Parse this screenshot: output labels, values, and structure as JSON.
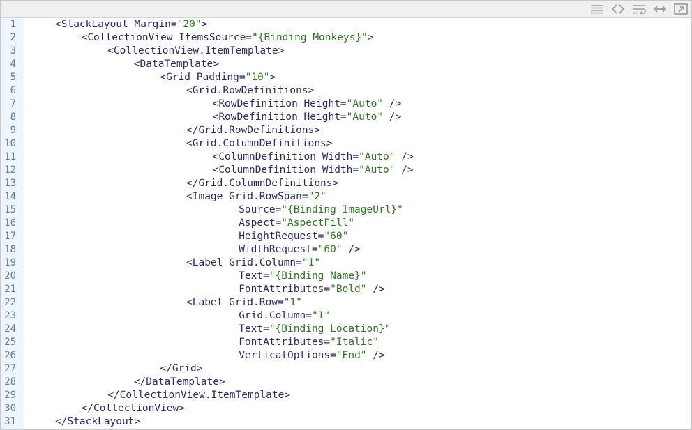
{
  "toolbar": {
    "icons": [
      "view-source-icon",
      "code-icon",
      "wrap-lines-icon",
      "expand-width-icon",
      "open-window-icon"
    ]
  },
  "code": {
    "lines": [
      {
        "num": "1",
        "indent": 0,
        "parts": [
          {
            "t": "<StackLayout Margin=",
            "c": "tag"
          },
          {
            "t": "\"20\"",
            "c": "str"
          },
          {
            "t": ">",
            "c": "tag"
          }
        ]
      },
      {
        "num": "2",
        "indent": 1,
        "parts": [
          {
            "t": "<CollectionView ItemsSource=",
            "c": "tag"
          },
          {
            "t": "\"{Binding Monkeys}\"",
            "c": "str"
          },
          {
            "t": ">",
            "c": "tag"
          }
        ]
      },
      {
        "num": "3",
        "indent": 2,
        "parts": [
          {
            "t": "<CollectionView.ItemTemplate>",
            "c": "tag"
          }
        ]
      },
      {
        "num": "4",
        "indent": 3,
        "parts": [
          {
            "t": "<DataTemplate>",
            "c": "tag"
          }
        ]
      },
      {
        "num": "5",
        "indent": 4,
        "parts": [
          {
            "t": "<Grid Padding=",
            "c": "tag"
          },
          {
            "t": "\"10\"",
            "c": "str"
          },
          {
            "t": ">",
            "c": "tag"
          }
        ]
      },
      {
        "num": "6",
        "indent": 5,
        "parts": [
          {
            "t": "<Grid.RowDefinitions>",
            "c": "tag"
          }
        ]
      },
      {
        "num": "7",
        "indent": 6,
        "parts": [
          {
            "t": "<RowDefinition Height=",
            "c": "tag"
          },
          {
            "t": "\"Auto\"",
            "c": "str"
          },
          {
            "t": " />",
            "c": "tag"
          }
        ]
      },
      {
        "num": "8",
        "indent": 6,
        "parts": [
          {
            "t": "<RowDefinition Height=",
            "c": "tag"
          },
          {
            "t": "\"Auto\"",
            "c": "str"
          },
          {
            "t": " />",
            "c": "tag"
          }
        ]
      },
      {
        "num": "9",
        "indent": 5,
        "parts": [
          {
            "t": "</Grid.RowDefinitions>",
            "c": "tag"
          }
        ]
      },
      {
        "num": "10",
        "indent": 5,
        "parts": [
          {
            "t": "<Grid.ColumnDefinitions>",
            "c": "tag"
          }
        ]
      },
      {
        "num": "11",
        "indent": 6,
        "parts": [
          {
            "t": "<ColumnDefinition Width=",
            "c": "tag"
          },
          {
            "t": "\"Auto\"",
            "c": "str"
          },
          {
            "t": " />",
            "c": "tag"
          }
        ]
      },
      {
        "num": "12",
        "indent": 6,
        "parts": [
          {
            "t": "<ColumnDefinition Width=",
            "c": "tag"
          },
          {
            "t": "\"Auto\"",
            "c": "str"
          },
          {
            "t": " />",
            "c": "tag"
          }
        ]
      },
      {
        "num": "13",
        "indent": 5,
        "parts": [
          {
            "t": "</Grid.ColumnDefinitions>",
            "c": "tag"
          }
        ]
      },
      {
        "num": "14",
        "indent": 5,
        "parts": [
          {
            "t": "<Image Grid.RowSpan=",
            "c": "tag"
          },
          {
            "t": "\"2\"",
            "c": "str"
          }
        ]
      },
      {
        "num": "15",
        "indent": 7,
        "parts": [
          {
            "t": "Source=",
            "c": "tag"
          },
          {
            "t": "\"{Binding ImageUrl}\"",
            "c": "str"
          }
        ]
      },
      {
        "num": "16",
        "indent": 7,
        "parts": [
          {
            "t": "Aspect=",
            "c": "tag"
          },
          {
            "t": "\"AspectFill\"",
            "c": "str"
          }
        ]
      },
      {
        "num": "17",
        "indent": 7,
        "parts": [
          {
            "t": "HeightRequest=",
            "c": "tag"
          },
          {
            "t": "\"60\"",
            "c": "str"
          }
        ]
      },
      {
        "num": "18",
        "indent": 7,
        "parts": [
          {
            "t": "WidthRequest=",
            "c": "tag"
          },
          {
            "t": "\"60\"",
            "c": "str"
          },
          {
            "t": " />",
            "c": "tag"
          }
        ]
      },
      {
        "num": "19",
        "indent": 5,
        "parts": [
          {
            "t": "<Label Grid.Column=",
            "c": "tag"
          },
          {
            "t": "\"1\"",
            "c": "str"
          }
        ]
      },
      {
        "num": "20",
        "indent": 7,
        "parts": [
          {
            "t": "Text=",
            "c": "tag"
          },
          {
            "t": "\"{Binding Name}\"",
            "c": "str"
          }
        ]
      },
      {
        "num": "21",
        "indent": 7,
        "parts": [
          {
            "t": "FontAttributes=",
            "c": "tag"
          },
          {
            "t": "\"Bold\"",
            "c": "str"
          },
          {
            "t": " />",
            "c": "tag"
          }
        ]
      },
      {
        "num": "22",
        "indent": 5,
        "parts": [
          {
            "t": "<Label Grid.Row=",
            "c": "tag"
          },
          {
            "t": "\"1\"",
            "c": "str"
          }
        ]
      },
      {
        "num": "23",
        "indent": 7,
        "parts": [
          {
            "t": "Grid.Column=",
            "c": "tag"
          },
          {
            "t": "\"1\"",
            "c": "str"
          }
        ]
      },
      {
        "num": "24",
        "indent": 7,
        "parts": [
          {
            "t": "Text=",
            "c": "tag"
          },
          {
            "t": "\"{Binding Location}\"",
            "c": "str"
          }
        ]
      },
      {
        "num": "25",
        "indent": 7,
        "parts": [
          {
            "t": "FontAttributes=",
            "c": "tag"
          },
          {
            "t": "\"Italic\"",
            "c": "str"
          }
        ]
      },
      {
        "num": "26",
        "indent": 7,
        "parts": [
          {
            "t": "VerticalOptions=",
            "c": "tag"
          },
          {
            "t": "\"End\"",
            "c": "str"
          },
          {
            "t": " />",
            "c": "tag"
          }
        ]
      },
      {
        "num": "27",
        "indent": 4,
        "parts": [
          {
            "t": "</Grid>",
            "c": "tag"
          }
        ]
      },
      {
        "num": "28",
        "indent": 3,
        "parts": [
          {
            "t": "</DataTemplate>",
            "c": "tag"
          }
        ]
      },
      {
        "num": "29",
        "indent": 2,
        "parts": [
          {
            "t": "</CollectionView.ItemTemplate>",
            "c": "tag"
          }
        ]
      },
      {
        "num": "30",
        "indent": 1,
        "parts": [
          {
            "t": "</CollectionView>",
            "c": "tag"
          }
        ]
      },
      {
        "num": "31",
        "indent": 0,
        "parts": [
          {
            "t": "</StackLayout>",
            "c": "tag"
          }
        ]
      }
    ]
  }
}
